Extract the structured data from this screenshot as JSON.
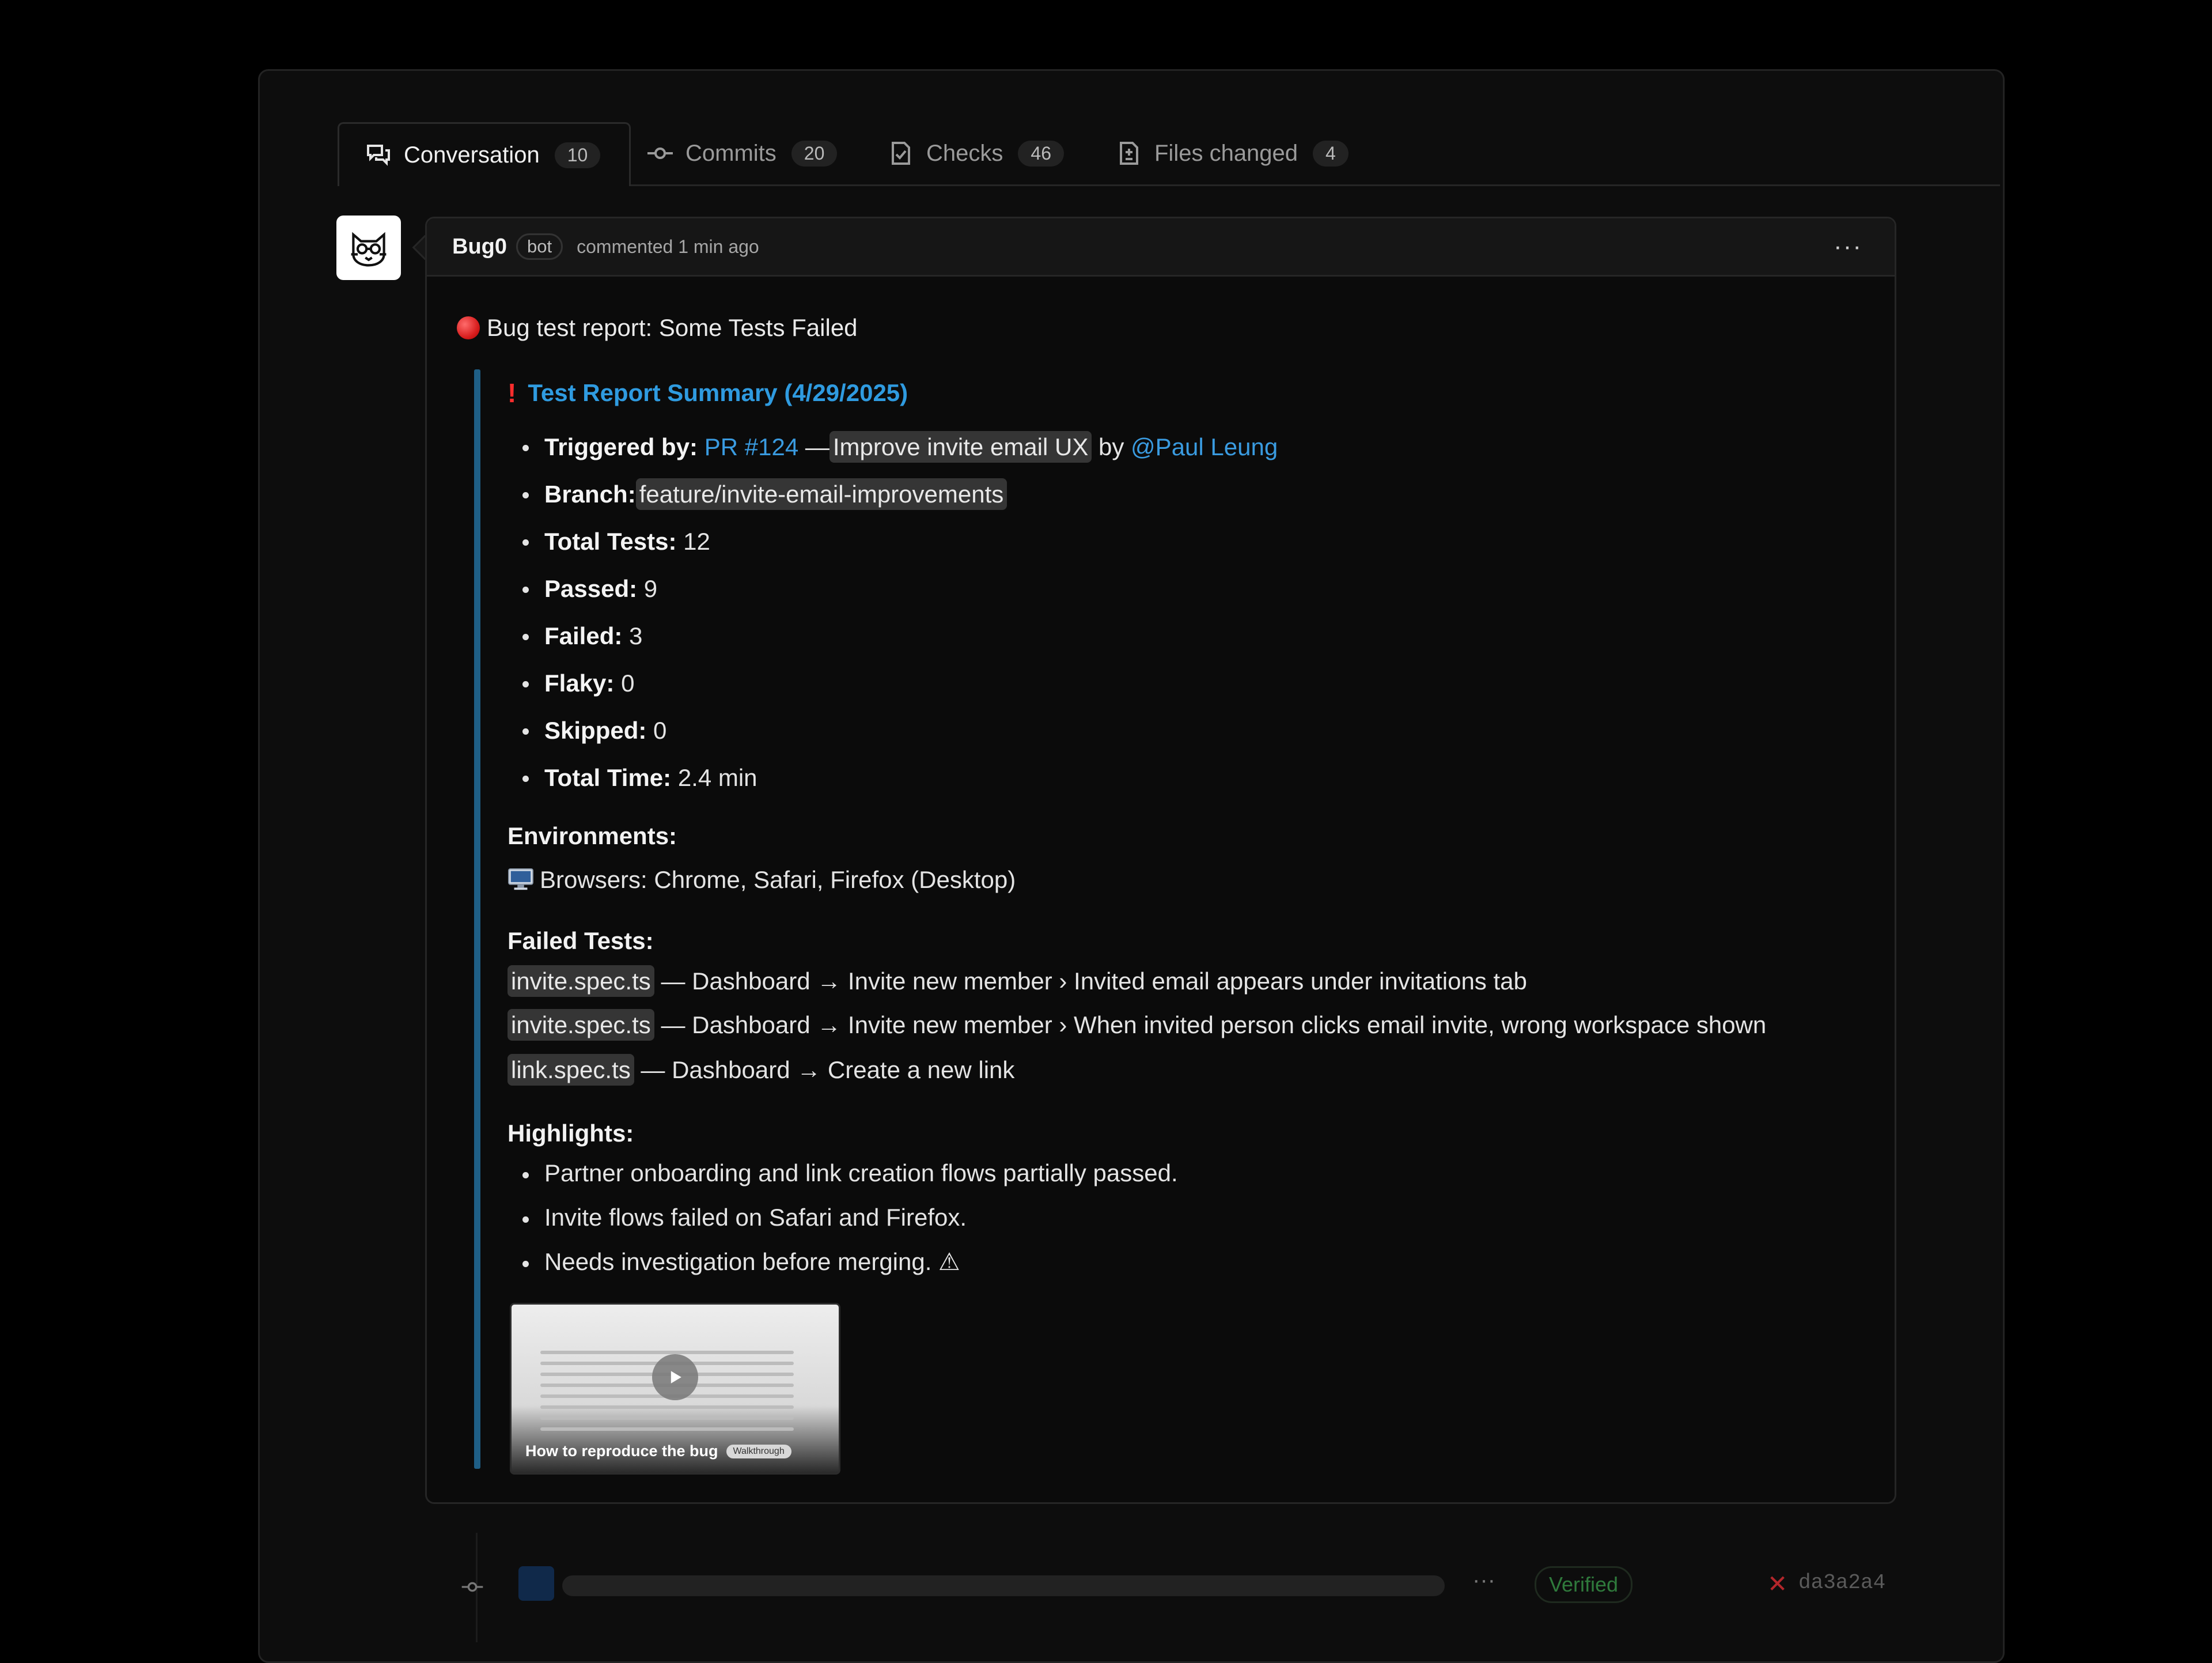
{
  "tabs": [
    {
      "label": "Conversation",
      "count": "10",
      "icon": "conversation-icon"
    },
    {
      "label": "Commits",
      "count": "20",
      "icon": "commit-icon"
    },
    {
      "label": "Checks",
      "count": "46",
      "icon": "checks-icon"
    },
    {
      "label": "Files changed",
      "count": "4",
      "icon": "file-diff-icon"
    }
  ],
  "comment": {
    "author": "Bug0",
    "badge": "bot",
    "meta": "commented 1 min ago",
    "more": "···",
    "title": "Bug test report: Some Tests Failed",
    "summary_title": "Test Report Summary (4/29/2025)",
    "summary_mark": "!",
    "triggered": {
      "label": "Triggered by:",
      "pr": "PR #124",
      "dash": "—",
      "pr_title": "Improve invite email UX",
      "by": "by",
      "user": "@Paul Leung"
    },
    "branch": {
      "label": "Branch:",
      "value": "feature/invite-email-improvements"
    },
    "stats": [
      {
        "label": "Total Tests:",
        "value": "12"
      },
      {
        "label": "Passed:",
        "value": "9"
      },
      {
        "label": "Failed:",
        "value": "3"
      },
      {
        "label": "Flaky:",
        "value": "0"
      },
      {
        "label": "Skipped:",
        "value": "0"
      },
      {
        "label": "Total Time:",
        "value": "2.4 min"
      }
    ],
    "env_heading": "Environments:",
    "env_line": "Browsers: Chrome, Safari, Firefox (Desktop)",
    "failed_heading": "Failed Tests:",
    "failed": [
      {
        "file": "invite.spec.ts",
        "text": "— Dashboard → Invite new member › Invited email appears under invitations tab"
      },
      {
        "file": "invite.spec.ts",
        "text": "— Dashboard → Invite new member › When invited person clicks email invite, wrong workspace shown"
      },
      {
        "file": "link.spec.ts",
        "text": "— Dashboard → Create a new link"
      }
    ],
    "highlights_heading": "Highlights:",
    "highlights": [
      "Partner onboarding and link creation flows partially passed.",
      "Invite flows failed on Safari and Firefox.",
      "Needs investigation before merging. ⚠"
    ],
    "video": {
      "caption": "How to reproduce the bug",
      "tag": "Walkthrough"
    }
  },
  "commit": {
    "more": "···",
    "verified": "Verified",
    "sha": "da3a2a4"
  },
  "colors": {
    "link": "#3a9be0",
    "accent_bar": "#1f5f86",
    "verified": "#2f7a3c",
    "fail": "#b3262b"
  }
}
